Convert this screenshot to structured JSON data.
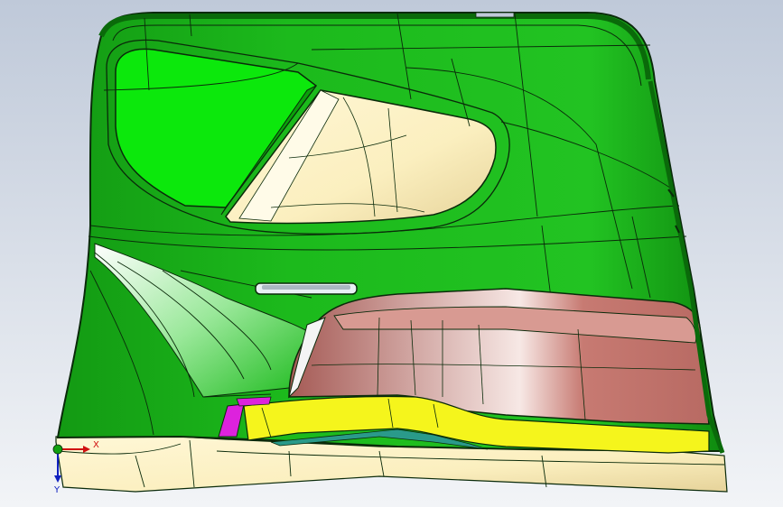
{
  "viewport": {
    "background_top": "#bfc9d9",
    "background_bottom": "#f2f4f7"
  },
  "model": {
    "panel_color": "#18b018",
    "window_color": "#0ce80c",
    "beige_color": "#fbefbf",
    "armrest_color": "#c77a72",
    "strip_color": "#f5f51c",
    "magenta_color": "#dd22dd",
    "teal_color": "#2a9a8a",
    "edge_color": "#0a2a0a"
  },
  "triad": {
    "x_label": "X",
    "y_label": "Y",
    "x_color": "#d01010",
    "y_color": "#1020c0",
    "origin_color": "#10a010"
  }
}
